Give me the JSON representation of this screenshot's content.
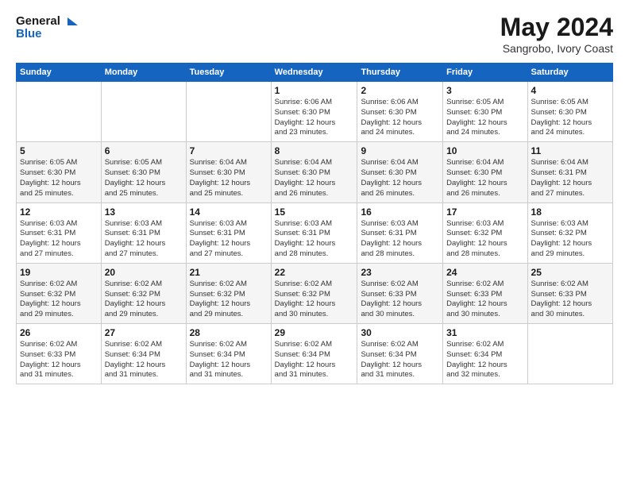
{
  "header": {
    "logo": {
      "line1": "General",
      "line2": "Blue"
    },
    "title": "May 2024",
    "location": "Sangrobo, Ivory Coast"
  },
  "weekdays": [
    "Sunday",
    "Monday",
    "Tuesday",
    "Wednesday",
    "Thursday",
    "Friday",
    "Saturday"
  ],
  "weeks": [
    [
      {
        "day": "",
        "info": ""
      },
      {
        "day": "",
        "info": ""
      },
      {
        "day": "",
        "info": ""
      },
      {
        "day": "1",
        "info": "Sunrise: 6:06 AM\nSunset: 6:30 PM\nDaylight: 12 hours\nand 23 minutes."
      },
      {
        "day": "2",
        "info": "Sunrise: 6:06 AM\nSunset: 6:30 PM\nDaylight: 12 hours\nand 24 minutes."
      },
      {
        "day": "3",
        "info": "Sunrise: 6:05 AM\nSunset: 6:30 PM\nDaylight: 12 hours\nand 24 minutes."
      },
      {
        "day": "4",
        "info": "Sunrise: 6:05 AM\nSunset: 6:30 PM\nDaylight: 12 hours\nand 24 minutes."
      }
    ],
    [
      {
        "day": "5",
        "info": "Sunrise: 6:05 AM\nSunset: 6:30 PM\nDaylight: 12 hours\nand 25 minutes."
      },
      {
        "day": "6",
        "info": "Sunrise: 6:05 AM\nSunset: 6:30 PM\nDaylight: 12 hours\nand 25 minutes."
      },
      {
        "day": "7",
        "info": "Sunrise: 6:04 AM\nSunset: 6:30 PM\nDaylight: 12 hours\nand 25 minutes."
      },
      {
        "day": "8",
        "info": "Sunrise: 6:04 AM\nSunset: 6:30 PM\nDaylight: 12 hours\nand 26 minutes."
      },
      {
        "day": "9",
        "info": "Sunrise: 6:04 AM\nSunset: 6:30 PM\nDaylight: 12 hours\nand 26 minutes."
      },
      {
        "day": "10",
        "info": "Sunrise: 6:04 AM\nSunset: 6:30 PM\nDaylight: 12 hours\nand 26 minutes."
      },
      {
        "day": "11",
        "info": "Sunrise: 6:04 AM\nSunset: 6:31 PM\nDaylight: 12 hours\nand 27 minutes."
      }
    ],
    [
      {
        "day": "12",
        "info": "Sunrise: 6:03 AM\nSunset: 6:31 PM\nDaylight: 12 hours\nand 27 minutes."
      },
      {
        "day": "13",
        "info": "Sunrise: 6:03 AM\nSunset: 6:31 PM\nDaylight: 12 hours\nand 27 minutes."
      },
      {
        "day": "14",
        "info": "Sunrise: 6:03 AM\nSunset: 6:31 PM\nDaylight: 12 hours\nand 27 minutes."
      },
      {
        "day": "15",
        "info": "Sunrise: 6:03 AM\nSunset: 6:31 PM\nDaylight: 12 hours\nand 28 minutes."
      },
      {
        "day": "16",
        "info": "Sunrise: 6:03 AM\nSunset: 6:31 PM\nDaylight: 12 hours\nand 28 minutes."
      },
      {
        "day": "17",
        "info": "Sunrise: 6:03 AM\nSunset: 6:32 PM\nDaylight: 12 hours\nand 28 minutes."
      },
      {
        "day": "18",
        "info": "Sunrise: 6:03 AM\nSunset: 6:32 PM\nDaylight: 12 hours\nand 29 minutes."
      }
    ],
    [
      {
        "day": "19",
        "info": "Sunrise: 6:02 AM\nSunset: 6:32 PM\nDaylight: 12 hours\nand 29 minutes."
      },
      {
        "day": "20",
        "info": "Sunrise: 6:02 AM\nSunset: 6:32 PM\nDaylight: 12 hours\nand 29 minutes."
      },
      {
        "day": "21",
        "info": "Sunrise: 6:02 AM\nSunset: 6:32 PM\nDaylight: 12 hours\nand 29 minutes."
      },
      {
        "day": "22",
        "info": "Sunrise: 6:02 AM\nSunset: 6:32 PM\nDaylight: 12 hours\nand 30 minutes."
      },
      {
        "day": "23",
        "info": "Sunrise: 6:02 AM\nSunset: 6:33 PM\nDaylight: 12 hours\nand 30 minutes."
      },
      {
        "day": "24",
        "info": "Sunrise: 6:02 AM\nSunset: 6:33 PM\nDaylight: 12 hours\nand 30 minutes."
      },
      {
        "day": "25",
        "info": "Sunrise: 6:02 AM\nSunset: 6:33 PM\nDaylight: 12 hours\nand 30 minutes."
      }
    ],
    [
      {
        "day": "26",
        "info": "Sunrise: 6:02 AM\nSunset: 6:33 PM\nDaylight: 12 hours\nand 31 minutes."
      },
      {
        "day": "27",
        "info": "Sunrise: 6:02 AM\nSunset: 6:34 PM\nDaylight: 12 hours\nand 31 minutes."
      },
      {
        "day": "28",
        "info": "Sunrise: 6:02 AM\nSunset: 6:34 PM\nDaylight: 12 hours\nand 31 minutes."
      },
      {
        "day": "29",
        "info": "Sunrise: 6:02 AM\nSunset: 6:34 PM\nDaylight: 12 hours\nand 31 minutes."
      },
      {
        "day": "30",
        "info": "Sunrise: 6:02 AM\nSunset: 6:34 PM\nDaylight: 12 hours\nand 31 minutes."
      },
      {
        "day": "31",
        "info": "Sunrise: 6:02 AM\nSunset: 6:34 PM\nDaylight: 12 hours\nand 32 minutes."
      },
      {
        "day": "",
        "info": ""
      }
    ]
  ]
}
